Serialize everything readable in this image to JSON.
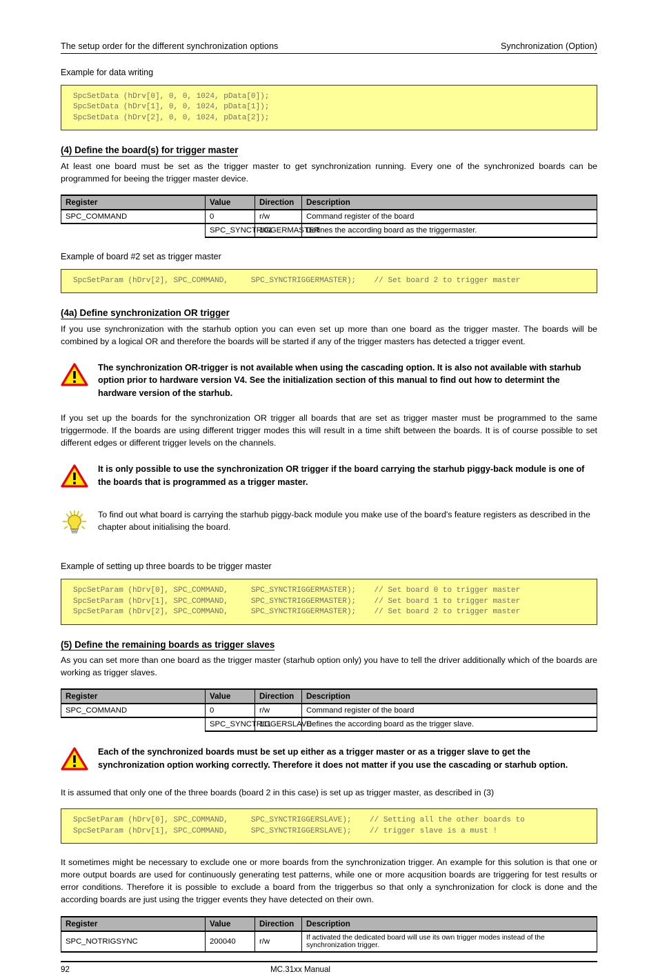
{
  "header": {
    "left": "The setup order for the different synchronization options",
    "right": "Synchronization (Option)"
  },
  "footer": {
    "page_number": "92",
    "manual": "MC.31xx Manual"
  },
  "colors": {
    "code_bg": "#ffff99",
    "code_text": "#6e6e6e",
    "table_header_bg": "#b3b3b3",
    "warning_fill": "#ffe600",
    "warning_stroke": "#e8000d",
    "bulb_fill": "#f5e03c"
  },
  "blocks": {
    "caption_data_writing": "Example for data writing",
    "code_data_writing": "SpcSetData (hDrv[0], 0, 0, 1024, pData[0]);\nSpcSetData (hDrv[1], 0, 0, 1024, pData[1]);\nSpcSetData (hDrv[2], 0, 0, 1024, pData[2]);",
    "heading_4": "(4) Define the board(s) for trigger master",
    "para_4": "At least one board must be set as the trigger master to get synchronization running. Every one of the synchronized boards can be programmed for beeing the trigger master device.",
    "caption_board2": "Example of board #2 set as trigger master",
    "code_board2": "SpcSetParam (hDrv[2], SPC_COMMAND,     SPC_SYNCTRIGGERMASTER);    // Set board 2 to trigger master",
    "heading_4a": "(4a) Define synchronization OR trigger",
    "para_4a": "If you use synchronization with the starhub option you can even set up more than one board as the trigger master. The boards will be combined by a logical OR and therefore the boards will be started if any of the trigger masters has detected a trigger event.",
    "warning_1": "The synchronization OR-trigger is not available when using the cascading option. It is also not available with starhub option prior to hardware version V4. See the initialization section of this manual to find out how to determint the hardware version of the starhub.",
    "para_4a_2": "If you set up the boards for the synchronization OR trigger all boards that are set as trigger master must be programmed to the same triggermode. If the boards are using different trigger modes this will result in a time shift between the boards. It is of course possible to set different edges or different trigger levels on the channels.",
    "warning_2": "It is only possible to use the synchronization OR trigger if the board carrying the starhub piggy-back module is one of the boards that is programmed as a trigger master.",
    "tip_1": "To find out what board is carrying the starhub piggy-back module you make use of the board's feature registers as described in the chapter about initialising the board.",
    "caption_three_boards": "Example of setting up three boards to be trigger master",
    "code_three_boards": "SpcSetParam (hDrv[0], SPC_COMMAND,     SPC_SYNCTRIGGERMASTER);    // Set board 0 to trigger master\nSpcSetParam (hDrv[1], SPC_COMMAND,     SPC_SYNCTRIGGERMASTER);    // Set board 1 to trigger master\nSpcSetParam (hDrv[2], SPC_COMMAND,     SPC_SYNCTRIGGERMASTER);    // Set board 2 to trigger master",
    "heading_5": "(5) Define the remaining boards as trigger slaves",
    "para_5": "As you can set more than one board as the trigger master (starhub option only) you have to tell the driver additionally which of the boards are working as trigger slaves.",
    "warning_3": "Each of the synchronized boards must be set up either as a trigger master or as a trigger slave to get the synchronization option working correctly. Therefore it does not matter if you use the cascading or starhub option.",
    "para_assumed": "It is assumed that only one of the three boards (board 2 in this case) is set up as trigger master, as described in (3)",
    "code_slaves": "SpcSetParam (hDrv[0], SPC_COMMAND,     SPC_SYNCTRIGGERSLAVE);    // Setting all the other boards to\nSpcSetParam (hDrv[1], SPC_COMMAND,     SPC_SYNCTRIGGERSLAVE);    // trigger slave is a must !",
    "para_exclude": "It sometimes might be necessary to exclude one or more boards from the synchronization trigger. An example for this solution is that one or more output boards are used for continuously generating test patterns, while one or more acqusition boards are triggering for test results or error conditions. Therefore it is possible to exclude a board from the triggerbus so that only a synchronization for clock is done and the according boards are just using the trigger events they have detected on their own."
  },
  "tables": {
    "columns": {
      "register": "Register",
      "value": "Value",
      "direction": "Direction",
      "description": "Description"
    },
    "master": {
      "main": {
        "register": "SPC_COMMAND",
        "value": "0",
        "direction": "r/w",
        "description": "Command register of the board"
      },
      "sub": {
        "register": "SPC_SYNCTRIGGERMASTER",
        "value": "101",
        "description": "Defines the according board as the triggermaster."
      }
    },
    "slave": {
      "main": {
        "register": "SPC_COMMAND",
        "value": "0",
        "direction": "r/w",
        "description": "Command register of the board"
      },
      "sub": {
        "register": "SPC_SYNCTRIGGERSLAVE",
        "value": "111",
        "description": "Defines the according board as the trigger slave."
      }
    },
    "notrigsync": {
      "main": {
        "register": "SPC_NOTRIGSYNC",
        "value": "200040",
        "direction": "r/w",
        "description": "If activated the dedicated board will use its own trigger modes instead of the synchronization trigger."
      }
    }
  },
  "icons": {
    "warning": "warning-triangle-icon",
    "tip": "lightbulb-icon"
  }
}
